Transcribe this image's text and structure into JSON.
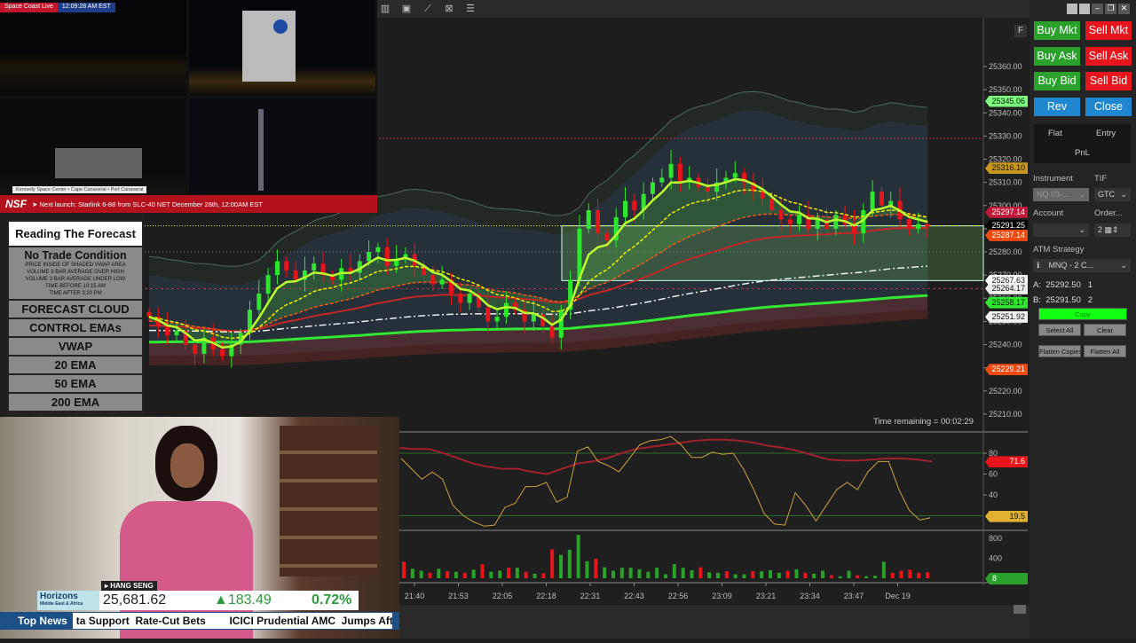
{
  "camera": {
    "channel": "Space Coast Live",
    "time": "12:09:28 AM EST",
    "locations": "Kennedy Space Center  •  Cape Canaveral  •  Port Canaveral",
    "logo": "NSF",
    "next_launch": "➤ Next launch: Starlink 6-88 from SLC-40 NET December 28th, 12:00AM EST"
  },
  "forecast": {
    "title": "Reading The Forecast",
    "no_trade": "No Trade Condition",
    "conditions": [
      "PRICE INSIDE OF SHADED VWAP AREA",
      "VOLUME 3 BAR AVERAGE OVER HIGH",
      "VOLUME 3 BAR AVERAGE UNDER LOW",
      "TIME BEFORE 10:15 AM",
      "TIME AFTER 3:20 PM"
    ],
    "items": [
      "FORECAST CLOUD",
      "CONTROL EMAs",
      "VWAP",
      "20 EMA",
      "50 EMA",
      "200 EMA"
    ]
  },
  "news": {
    "brand": "Horizons",
    "brand_sub": "Middle East & Africa",
    "index_name": "▸ HANG SENG",
    "index_value": "25,681.62",
    "change": "▲183.49",
    "change_pct": "0.72%",
    "label": "Top News",
    "ticker": "ta Support  Rate-Cut Bets        ICICI Prudential AMC  Jumps After"
  },
  "toolbar": {
    "icons": [
      "bar-chart-icon",
      "data-box-icon",
      "drawing-tools-icon",
      "strategy-icon",
      "properties-icon"
    ]
  },
  "chart": {
    "f_label": "F",
    "time_remaining": "Time remaining = 00:02:29",
    "price_axis": [
      "25360.00",
      "25350.00",
      "25340.00",
      "25330.00",
      "25320.00",
      "25310.00",
      "25300.00",
      "25290.00",
      "25280.00",
      "25270.00",
      "25260.00",
      "25250.00",
      "25240.00",
      "25230.00",
      "25220.00",
      "25210.00"
    ],
    "price_tags": [
      {
        "v": "25345.06",
        "p": 25345.06,
        "bg": "#7dff7d",
        "fg": "#111"
      },
      {
        "v": "25316.10",
        "p": 25316.1,
        "bg": "#c7971f",
        "fg": "#111"
      },
      {
        "v": "25297.14",
        "p": 25297.14,
        "bg": "#c01a3a",
        "fg": "#fff"
      },
      {
        "v": "25291.25",
        "p": 25291.25,
        "bg": "#000",
        "fg": "#fff"
      },
      {
        "v": "25287.14",
        "p": 25287.14,
        "bg": "#f04a10",
        "fg": "#fff"
      },
      {
        "v": "25267.63",
        "p": 25267.63,
        "bg": "#fff",
        "fg": "#111"
      },
      {
        "v": "25264.17",
        "p": 25264.17,
        "bg": "#eee",
        "fg": "#111"
      },
      {
        "v": "25258.17",
        "p": 25258.17,
        "bg": "#2ee62e",
        "fg": "#111"
      },
      {
        "v": "25251.92",
        "p": 25251.92,
        "bg": "#f2f2f2",
        "fg": "#111"
      },
      {
        "v": "25229.21",
        "p": 25229.21,
        "bg": "#f04a10",
        "fg": "#fff"
      }
    ],
    "time_axis": [
      "21:40",
      "21:53",
      "22:05",
      "22:18",
      "22:31",
      "22:43",
      "22:56",
      "23:09",
      "23:21",
      "23:34",
      "23:47",
      "Dec 19"
    ],
    "closes": [
      25252,
      25248,
      25244,
      25246,
      25240,
      25236,
      25243,
      25238,
      25235,
      25240,
      25245,
      25255,
      25262,
      25270,
      25276,
      25272,
      25268,
      25272,
      25275,
      25270,
      25268,
      25273,
      25271,
      25276,
      25280,
      25282,
      25274,
      25277,
      25279,
      25274,
      25270,
      25266,
      25268,
      25262,
      25258,
      25262,
      25256,
      25250,
      25252,
      25258,
      25255,
      25250,
      25253,
      25248,
      25243,
      25255,
      25268,
      25290,
      25298,
      25288,
      25285,
      25295,
      25302,
      25298,
      25305,
      25310,
      25312,
      25318,
      25310,
      25312,
      25308,
      25306,
      25310,
      25312,
      25314,
      25310,
      25306,
      25303,
      25298,
      25294,
      25292,
      25296,
      25290,
      25294,
      25290,
      25296,
      25292,
      25288,
      25298,
      25306,
      25300,
      25302,
      25294,
      25290,
      25292,
      25291
    ],
    "osc_axis": [
      "80",
      "60",
      "40"
    ],
    "osc_tags": [
      {
        "v": "71.6",
        "p": 71.6,
        "bg": "#e8141b",
        "fg": "#fff"
      },
      {
        "v": "19.5",
        "p": 19.5,
        "bg": "#e0b030",
        "fg": "#111"
      }
    ],
    "osc_fast": [
      75,
      65,
      55,
      62,
      55,
      30,
      20,
      14,
      10,
      11,
      28,
      32,
      48,
      48,
      52,
      33,
      38,
      82,
      86,
      72,
      68,
      62,
      75,
      88,
      92,
      93,
      96,
      88,
      76,
      76,
      81,
      79,
      80,
      65,
      45,
      22,
      12,
      11,
      42,
      30,
      15,
      30,
      45,
      52,
      45,
      62,
      72,
      72,
      45,
      25,
      16,
      18
    ],
    "osc_slow": [
      85,
      84,
      84,
      80,
      75,
      70,
      67,
      65,
      65,
      62,
      60,
      65,
      70,
      72,
      75,
      80,
      84,
      86,
      88,
      90,
      92,
      93,
      93,
      92,
      90,
      87,
      85,
      82,
      78,
      74,
      73,
      73,
      74,
      75,
      75,
      74,
      72
    ],
    "vol_axis": [
      "800",
      "400"
    ],
    "vol_tag": "8",
    "volumes": [
      330,
      190,
      150,
      110,
      190,
      140,
      130,
      110,
      170,
      280,
      130,
      150,
      210,
      210,
      130,
      90,
      100,
      580,
      470,
      570,
      870,
      340,
      390,
      220,
      150,
      210,
      210,
      180,
      130,
      210,
      80,
      280,
      210,
      160,
      220,
      120,
      110,
      140,
      80,
      80,
      140,
      140,
      160,
      110,
      150,
      180,
      110,
      90,
      150,
      60,
      40,
      150,
      60,
      40,
      50,
      330,
      110,
      150,
      170,
      110,
      120
    ]
  },
  "panel": {
    "buy_mkt": "Buy Mkt",
    "sell_mkt": "Sell Mkt",
    "buy_ask": "Buy Ask",
    "sell_ask": "Sell Ask",
    "buy_bid": "Buy Bid",
    "sell_bid": "Sell Bid",
    "rev": "Rev",
    "close": "Close",
    "flat": "Flat",
    "entry": "Entry",
    "pnl": "PnL",
    "instrument_label": "Instrument",
    "instrument": "NQ 03-...",
    "tif_label": "TIF",
    "tif": "GTC",
    "account_label": "Account",
    "account": "",
    "order_label": "Order...",
    "order_qty": "2",
    "atm_label": "ATM Strategy",
    "atm": "MNQ - 2 C...",
    "ask": "A:  25292.50   1",
    "bid": "B:  25291.50   2",
    "copy": "Copy",
    "select_all": "Select All",
    "clear": "Clear",
    "flatten_copies": "Flatten Copies",
    "flatten_all": "Flatten All"
  }
}
